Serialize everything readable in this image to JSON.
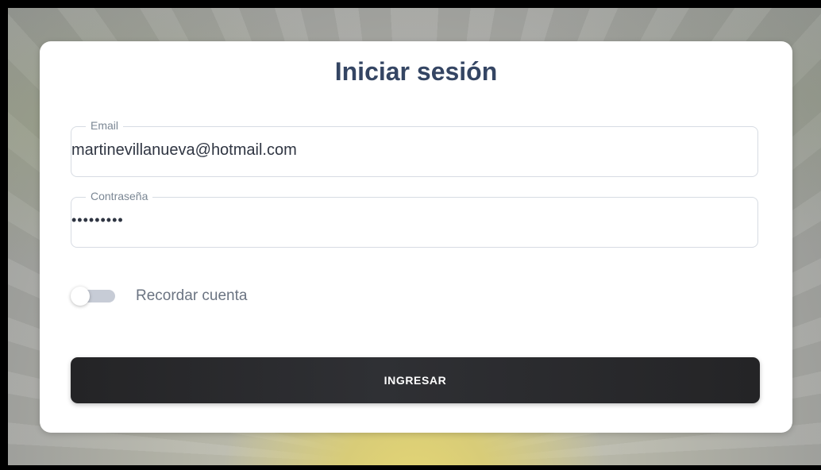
{
  "login": {
    "title": "Iniciar sesión",
    "email": {
      "label": "Email",
      "value": "martinevillanueva@hotmail.com"
    },
    "password": {
      "label": "Contraseña",
      "masked_value": "•••••••••"
    },
    "remember": {
      "label": "Recordar cuenta",
      "enabled": false
    },
    "submit_label": "INGRESAR"
  },
  "colors": {
    "title": "#344563",
    "button": "#2b2c30",
    "field_border": "#d7dce3"
  }
}
